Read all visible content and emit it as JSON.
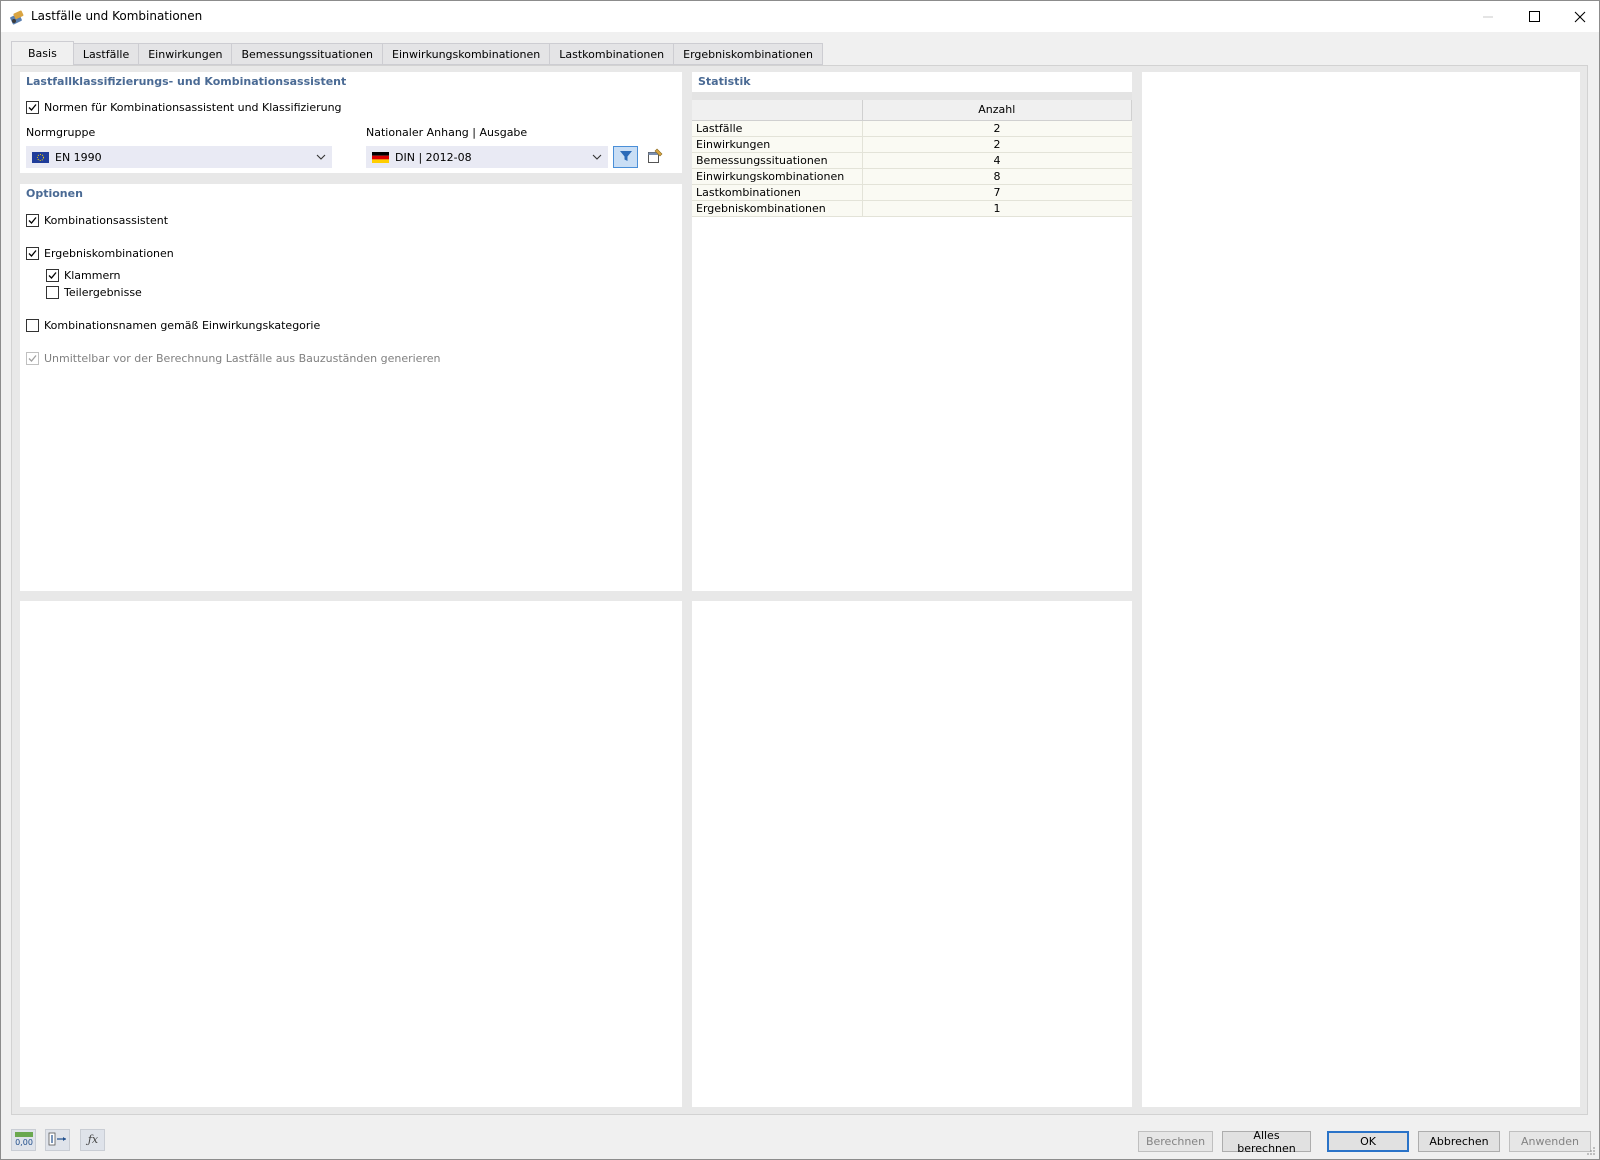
{
  "window": {
    "title": "Lastfälle und Kombinationen"
  },
  "tabs": [
    {
      "label": "Basis",
      "active": true
    },
    {
      "label": "Lastfälle"
    },
    {
      "label": "Einwirkungen"
    },
    {
      "label": "Bemessungssituationen"
    },
    {
      "label": "Einwirkungskombinationen"
    },
    {
      "label": "Lastkombinationen"
    },
    {
      "label": "Ergebniskombinationen"
    }
  ],
  "assistant": {
    "title": "Lastfallklassifizierungs- und Kombinationsassistent",
    "norms_checkbox": {
      "label": "Normen für Kombinationsassistent und Klassifizierung",
      "checked": true
    },
    "normgruppe_label": "Normgruppe",
    "normgruppe_value": "EN 1990",
    "annex_label": "Nationaler Anhang | Ausgabe",
    "annex_value": "DIN | 2012-08"
  },
  "options": {
    "title": "Optionen",
    "kombinationsassistent": {
      "label": "Kombinationsassistent",
      "checked": true
    },
    "ergebniskombinationen": {
      "label": "Ergebniskombinationen",
      "checked": true
    },
    "klammern": {
      "label": "Klammern",
      "checked": true
    },
    "teilergebnisse": {
      "label": "Teilergebnisse",
      "checked": false
    },
    "kombinationsnamen": {
      "label": "Kombinationsnamen gemäß Einwirkungskategorie",
      "checked": false
    },
    "unmittelbar": {
      "label": "Unmittelbar vor der Berechnung Lastfälle aus Bauzuständen generieren",
      "checked": true,
      "disabled": true
    }
  },
  "statistik": {
    "title": "Statistik",
    "column_header": "Anzahl",
    "rows": [
      {
        "name": "Lastfälle",
        "value": "2"
      },
      {
        "name": "Einwirkungen",
        "value": "2"
      },
      {
        "name": "Bemessungssituationen",
        "value": "4"
      },
      {
        "name": "Einwirkungskombinationen",
        "value": "8"
      },
      {
        "name": "Lastkombinationen",
        "value": "7"
      },
      {
        "name": "Ergebniskombinationen",
        "value": "1"
      }
    ]
  },
  "bottom_icons": [
    {
      "name": "decimal-places-icon",
      "text": "0,00"
    },
    {
      "name": "units-icon"
    },
    {
      "name": "function-icon",
      "text": "ƒx"
    }
  ],
  "buttons": {
    "berechnen": "Berechnen",
    "alles_berechnen": "Alles berechnen",
    "ok": "OK",
    "abbrechen": "Abbrechen",
    "anwenden": "Anwenden"
  },
  "colors": {
    "section_title": "#4a6a94",
    "combo_bg": "#e9eaf4",
    "default_button_border": "#2a73c8",
    "table_row_bg": "#fafaf3"
  }
}
